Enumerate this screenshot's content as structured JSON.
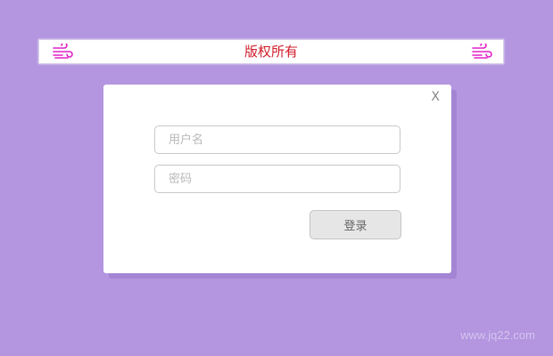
{
  "banner": {
    "title": "版权所有",
    "left_icon": "wind-icon",
    "right_icon": "wind-icon",
    "title_color": "#d11c2a",
    "icon_color": "#e020c8"
  },
  "dialog": {
    "close_label": "X",
    "username": {
      "placeholder": "用户名",
      "value": ""
    },
    "password": {
      "placeholder": "密码",
      "value": ""
    },
    "login_label": "登录"
  },
  "watermark": "www.jq22.com",
  "colors": {
    "background": "#b395e0",
    "dialog_bg": "#ffffff"
  }
}
